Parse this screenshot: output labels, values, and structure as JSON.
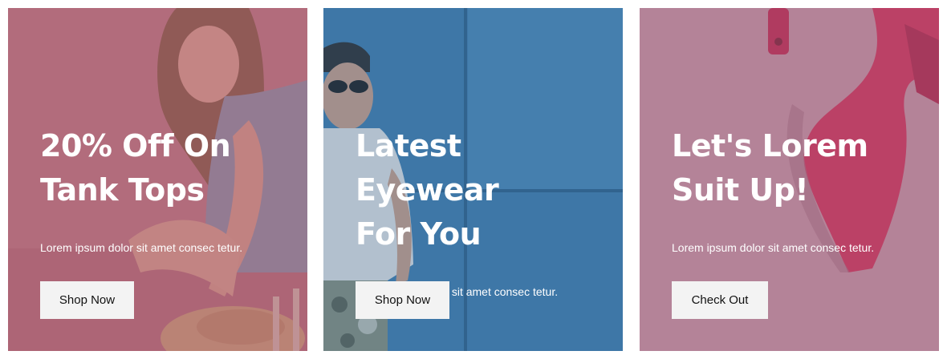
{
  "cards": [
    {
      "title_line1": "20% Off On",
      "title_line2": "Tank Tops",
      "subtitle": "Lorem ipsum dolor sit amet consec tetur.",
      "button_label": "Shop Now",
      "overlay_color": "#b05a70"
    },
    {
      "title_line1": "Latest Eyewear",
      "title_line2": "For You",
      "subtitle": "Lorem ipsum dolor sit amet consec tetur.",
      "button_label": "Shop Now",
      "overlay_color": "#3f6f92"
    },
    {
      "title_line1": "Let's Lorem",
      "title_line2": "Suit Up!",
      "subtitle": "Lorem ipsum dolor sit amet consec tetur.",
      "button_label": "Check Out",
      "overlay_color": "#a87b8f"
    }
  ]
}
